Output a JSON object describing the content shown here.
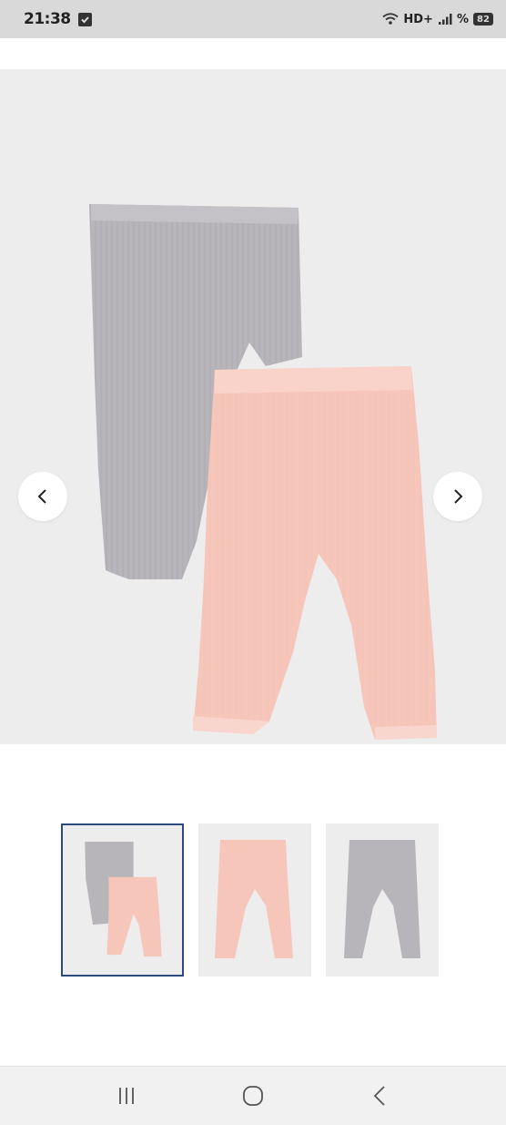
{
  "status_bar": {
    "time": "21:38",
    "network_label": "HD+",
    "percent_sign": "%",
    "battery_level": "82"
  },
  "gallery": {
    "close_icon": "close-icon",
    "prev_icon": "chevron-left-icon",
    "next_icon": "chevron-right-icon",
    "selected_index": 0,
    "product_colors": {
      "grey": "#b3b1b6",
      "pink": "#f6c6bb"
    },
    "thumbnails": [
      {
        "name": "thumbnail-two-pack",
        "selected": true
      },
      {
        "name": "thumbnail-pink-leggings",
        "selected": false
      },
      {
        "name": "thumbnail-grey-leggings",
        "selected": false
      }
    ]
  },
  "navigation_bar": {
    "recents_icon": "recent-apps-icon",
    "home_icon": "home-icon",
    "back_icon": "back-icon"
  }
}
